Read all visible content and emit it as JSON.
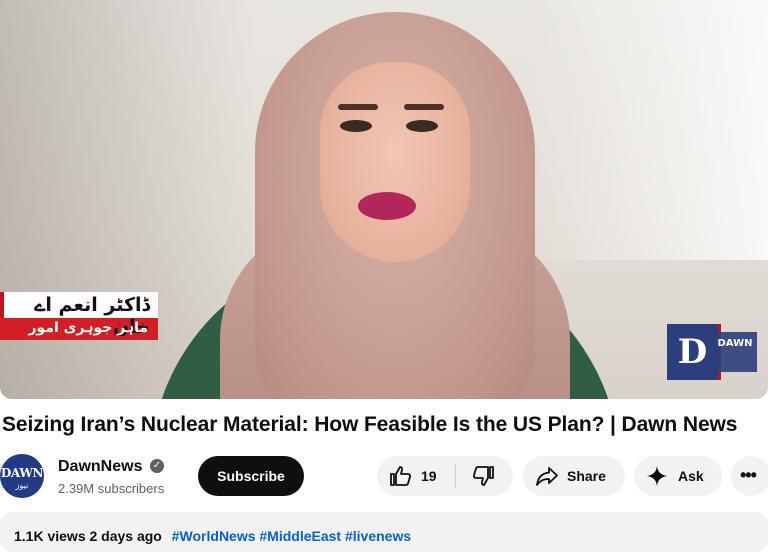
{
  "video": {
    "caption_name": "ڈاکٹر انعم اے خان",
    "caption_title": "ماہر جوہری امور",
    "watermark_letter": "D",
    "watermark_text": "DAWN"
  },
  "title": "Seizing Iran’s Nuclear Material: How Feasible Is the US Plan? | Dawn News",
  "channel": {
    "name": "DawnNews",
    "subscribers": "2.39M subscribers",
    "avatar_text": "DAWN",
    "avatar_subtext": "نیوز",
    "verified_glyph": "✓"
  },
  "actions": {
    "subscribe": "Subscribe",
    "like_count": "19",
    "share": "Share",
    "ask": "Ask",
    "more": "•••"
  },
  "description": {
    "meta": "1.1K views  2 days ago",
    "tags": "#WorldNews #MiddleEast #livenews"
  },
  "colors": {
    "accent_red": "#d21f26",
    "dawn_blue": "#2b3f7d",
    "link_blue": "#065fd4"
  }
}
